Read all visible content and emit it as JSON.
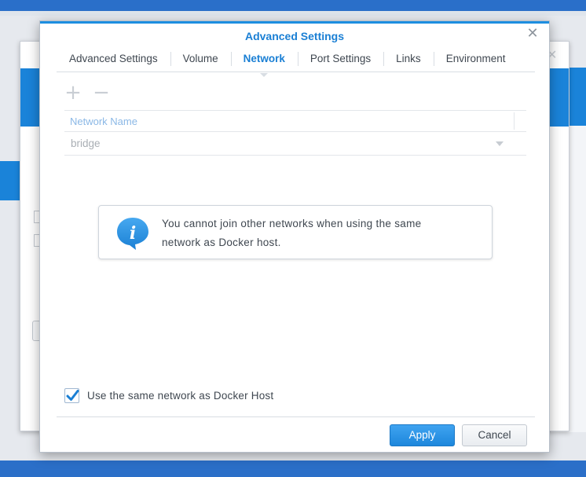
{
  "dialog": {
    "title": "Advanced Settings",
    "close_icon": "close-icon"
  },
  "tabs": [
    {
      "label": "Advanced Settings",
      "active": false
    },
    {
      "label": "Volume",
      "active": false
    },
    {
      "label": "Network",
      "active": true
    },
    {
      "label": "Port Settings",
      "active": false
    },
    {
      "label": "Links",
      "active": false
    },
    {
      "label": "Environment",
      "active": false
    }
  ],
  "toolbar": {
    "add_symbol": "+",
    "remove_symbol": "−"
  },
  "grid": {
    "column_header": "Network Name",
    "rows": [
      {
        "network_name": "bridge"
      }
    ]
  },
  "info": {
    "icon": "info-icon",
    "line1": "You cannot join other networks when using the same",
    "line2": "network as Docker host."
  },
  "options": {
    "same_network_label": "Use the same network as Docker Host",
    "same_network_checked": true
  },
  "footer": {
    "apply_label": "Apply",
    "cancel_label": "Cancel"
  },
  "colors": {
    "accent": "#1a7fd4",
    "apply_button": "#2b93e6",
    "desktop_blue": "#2a6fc9"
  }
}
